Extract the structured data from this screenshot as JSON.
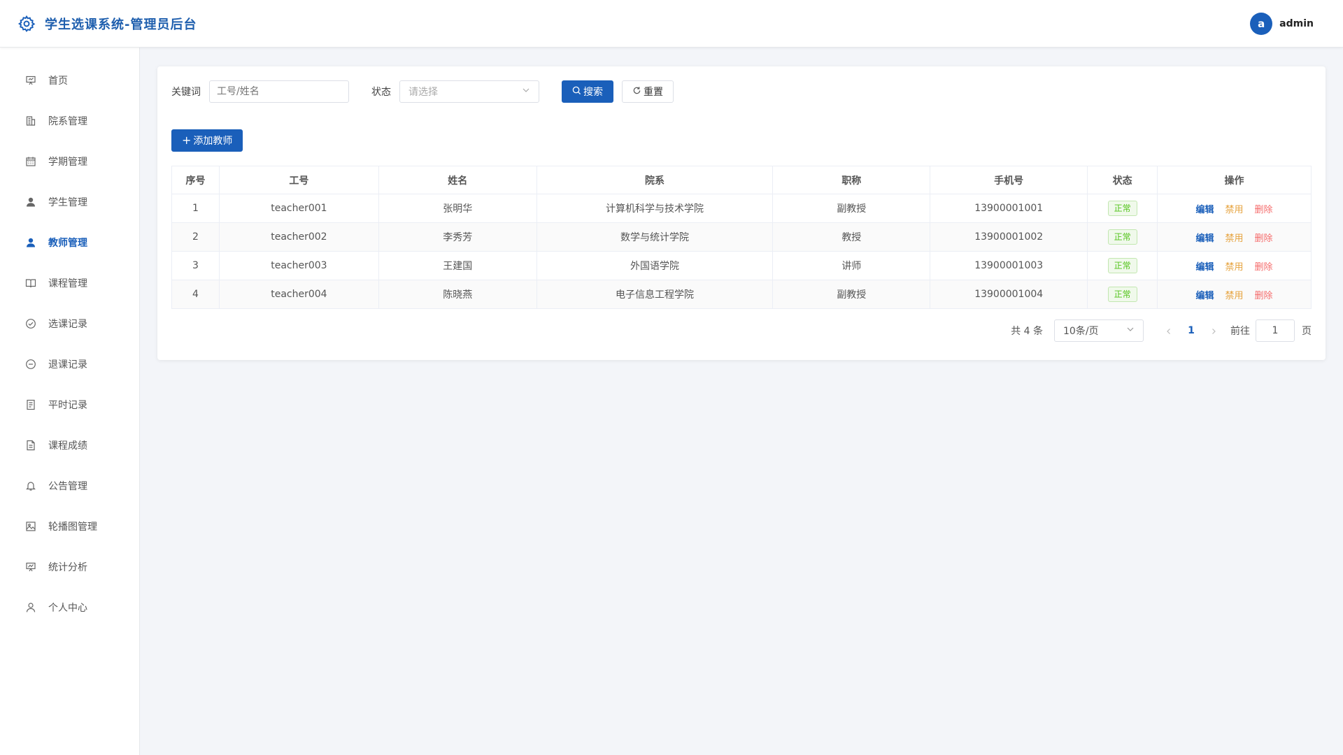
{
  "app": {
    "title": "学生选课系统-管理员后台",
    "logo_icon": "gear-icon",
    "accent_color": "#1a5fba"
  },
  "user": {
    "avatar_letter": "a",
    "name": "admin"
  },
  "sidebar": {
    "items": [
      {
        "label": "首页",
        "icon": "presentation-icon",
        "active": false
      },
      {
        "label": "院系管理",
        "icon": "building-icon",
        "active": false
      },
      {
        "label": "学期管理",
        "icon": "calendar-icon",
        "active": false
      },
      {
        "label": "学生管理",
        "icon": "user-filled-icon",
        "active": false
      },
      {
        "label": "教师管理",
        "icon": "user-filled-icon",
        "active": true
      },
      {
        "label": "课程管理",
        "icon": "book-icon",
        "active": false
      },
      {
        "label": "选课记录",
        "icon": "check-circle-icon",
        "active": false
      },
      {
        "label": "退课记录",
        "icon": "minus-circle-icon",
        "active": false
      },
      {
        "label": "平时记录",
        "icon": "notes-icon",
        "active": false
      },
      {
        "label": "课程成绩",
        "icon": "document-icon",
        "active": false
      },
      {
        "label": "公告管理",
        "icon": "bell-icon",
        "active": false
      },
      {
        "label": "轮播图管理",
        "icon": "image-icon",
        "active": false
      },
      {
        "label": "统计分析",
        "icon": "chart-board-icon",
        "active": false
      },
      {
        "label": "个人中心",
        "icon": "user-outline-icon",
        "active": false
      }
    ]
  },
  "search": {
    "keyword_label": "关键词",
    "keyword_placeholder": "工号/姓名",
    "status_label": "状态",
    "status_placeholder": "请选择",
    "search_button": "搜索",
    "reset_button": "重置"
  },
  "add_button": "添加教师",
  "table": {
    "columns": [
      "序号",
      "工号",
      "姓名",
      "院系",
      "职称",
      "手机号",
      "状态",
      "操作"
    ],
    "rows": [
      {
        "index": "1",
        "id": "teacher001",
        "name": "张明华",
        "dept": "计算机科学与技术学院",
        "title": "副教授",
        "phone": "13900001001",
        "status": "正常"
      },
      {
        "index": "2",
        "id": "teacher002",
        "name": "李秀芳",
        "dept": "数学与统计学院",
        "title": "教授",
        "phone": "13900001002",
        "status": "正常"
      },
      {
        "index": "3",
        "id": "teacher003",
        "name": "王建国",
        "dept": "外国语学院",
        "title": "讲师",
        "phone": "13900001003",
        "status": "正常"
      },
      {
        "index": "4",
        "id": "teacher004",
        "name": "陈晓燕",
        "dept": "电子信息工程学院",
        "title": "副教授",
        "phone": "13900001004",
        "status": "正常"
      }
    ],
    "actions": {
      "edit": "编辑",
      "disable": "禁用",
      "delete": "删除"
    }
  },
  "pagination": {
    "total_text": "共 4 条",
    "page_size": "10条/页",
    "current_page": "1",
    "goto_label": "前往",
    "goto_value": "1",
    "page_suffix": "页"
  }
}
